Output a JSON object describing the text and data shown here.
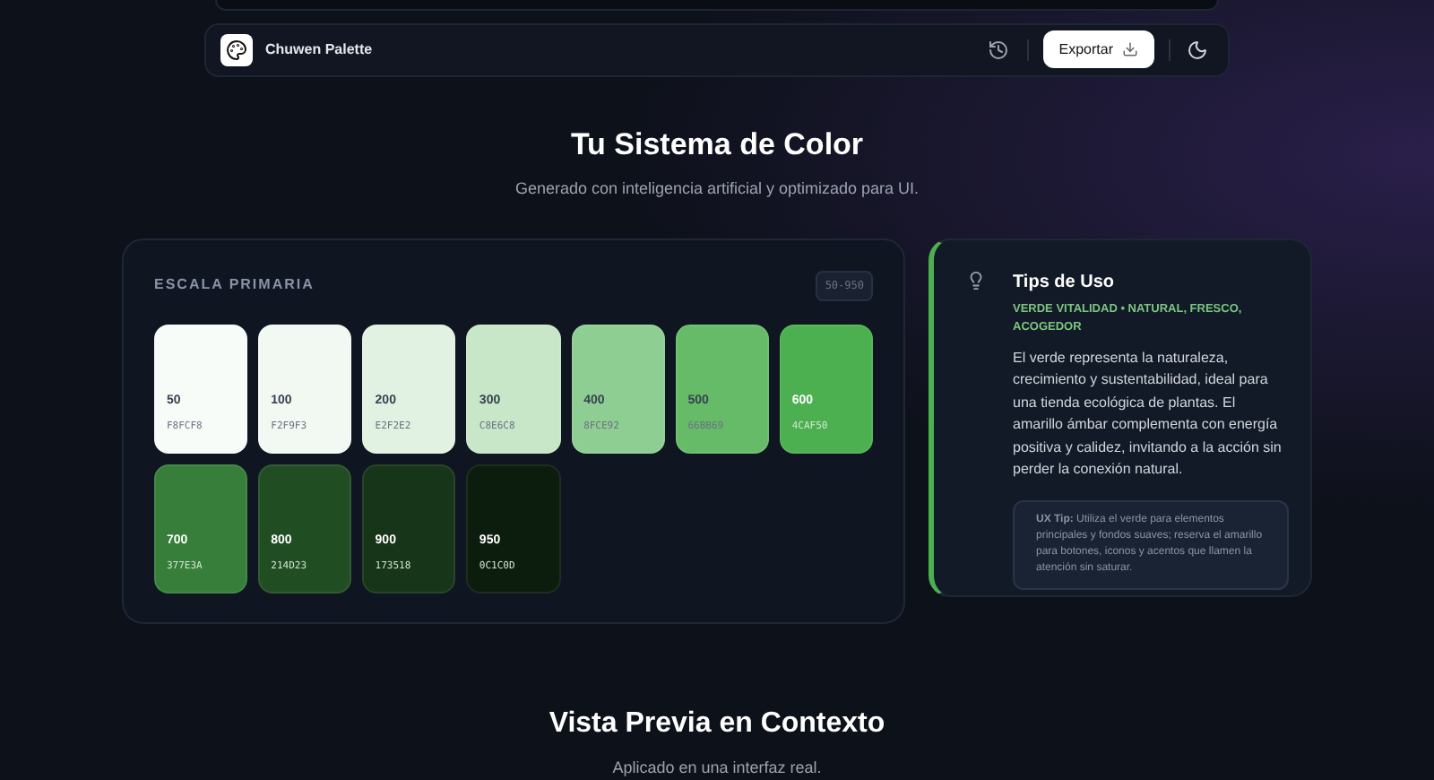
{
  "header": {
    "brand": "Chuwen Palette",
    "export_button": "Exportar"
  },
  "hero": {
    "title": "Tu Sistema de Color",
    "subtitle": "Generado con inteligencia artificial y optimizado para UI."
  },
  "scale": {
    "title": "ESCALA PRIMARIA",
    "range_badge": "50-950",
    "swatches": [
      {
        "step": "50",
        "hex": "F8FCF8",
        "color": "#f8fcf8",
        "kind": "light"
      },
      {
        "step": "100",
        "hex": "F2F9F3",
        "color": "#f2f9f3",
        "kind": "light"
      },
      {
        "step": "200",
        "hex": "E2F2E2",
        "color": "#e2f2e2",
        "kind": "light"
      },
      {
        "step": "300",
        "hex": "C8E6C8",
        "color": "#c8e6c8",
        "kind": "light"
      },
      {
        "step": "400",
        "hex": "8FCE92",
        "color": "#8fce92",
        "kind": "light"
      },
      {
        "step": "500",
        "hex": "66BB69",
        "color": "#66bb69",
        "kind": "light"
      },
      {
        "step": "600",
        "hex": "4CAF50",
        "color": "#4caf50",
        "kind": "dark"
      },
      {
        "step": "700",
        "hex": "377E3A",
        "color": "#377e3a",
        "kind": "dark"
      },
      {
        "step": "800",
        "hex": "214D23",
        "color": "#214d23",
        "kind": "dark"
      },
      {
        "step": "900",
        "hex": "173518",
        "color": "#173518",
        "kind": "dark"
      },
      {
        "step": "950",
        "hex": "0C1C0D",
        "color": "#0c1c0d",
        "kind": "dark"
      }
    ]
  },
  "tips": {
    "title": "Tips de Uso",
    "subtitle": "VERDE VITALIDAD • NATURAL, FRESCO, ACOGEDOR",
    "body": "El verde representa la naturaleza, crecimiento y sustentabilidad, ideal para una tienda ecológica de plantas. El amarillo ámbar complementa con energía positiva y calidez, invitando a la acción sin perder la conexión natural.",
    "ux_tip": "**UX Tip:** Utiliza el verde para elementos principales y fondos suaves; reserva el amarillo para botones, iconos y acentos que llamen la atención sin saturar."
  },
  "preview": {
    "title": "Vista Previa en Contexto",
    "subtitle": "Aplicado en una interfaz real."
  }
}
